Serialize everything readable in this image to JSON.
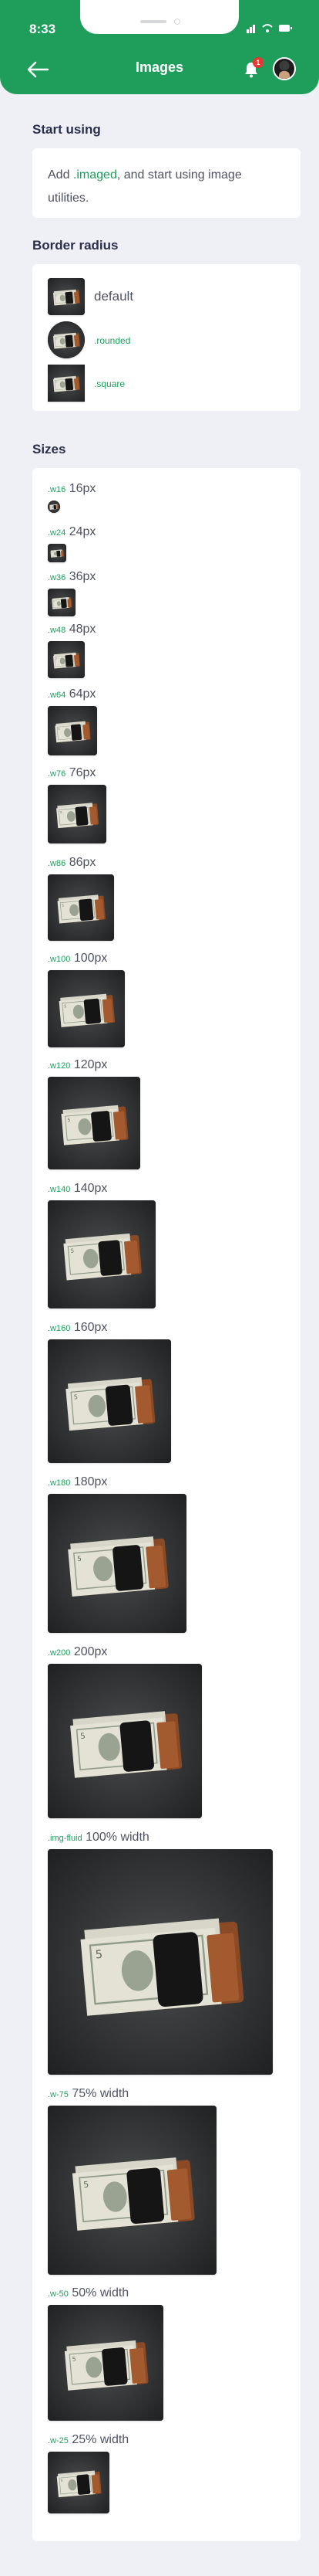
{
  "status_bar": {
    "time": "8:33"
  },
  "header": {
    "title": "Images",
    "badge_count": "1"
  },
  "sections": {
    "start_using": {
      "title": "Start using",
      "text_before": "Add ",
      "code": ".imaged",
      "text_after": ", and start using image utilities."
    },
    "border_radius": {
      "title": "Border radius",
      "items": [
        {
          "label": "default"
        },
        {
          "label": ".rounded"
        },
        {
          "label": ".square"
        }
      ]
    },
    "sizes": {
      "title": "Sizes",
      "items": [
        {
          "cls": ".w16",
          "text": "16px"
        },
        {
          "cls": ".w24",
          "text": "24px"
        },
        {
          "cls": ".w36",
          "text": "36px"
        },
        {
          "cls": ".w48",
          "text": "48px"
        },
        {
          "cls": ".w64",
          "text": "64px"
        },
        {
          "cls": ".w76",
          "text": "76px"
        },
        {
          "cls": ".w86",
          "text": "86px"
        },
        {
          "cls": ".w100",
          "text": "100px"
        },
        {
          "cls": ".w120",
          "text": "120px"
        },
        {
          "cls": ".w140",
          "text": "140px"
        },
        {
          "cls": ".w160",
          "text": "160px"
        },
        {
          "cls": ".w180",
          "text": "180px"
        },
        {
          "cls": ".w200",
          "text": "200px"
        },
        {
          "cls": ".img-fluid",
          "text": "100% width"
        },
        {
          "cls": ".w-75",
          "text": "75% width"
        },
        {
          "cls": ".w-50",
          "text": "50% width"
        },
        {
          "cls": ".w-25",
          "text": "25% width"
        }
      ]
    }
  },
  "colors": {
    "accent": "#1e9d5b",
    "background": "#eef0f6",
    "title": "#2b2f4a"
  },
  "icons": [
    "back-arrow-icon",
    "notification-bell-icon",
    "signal-icon",
    "wifi-icon",
    "battery-icon"
  ]
}
